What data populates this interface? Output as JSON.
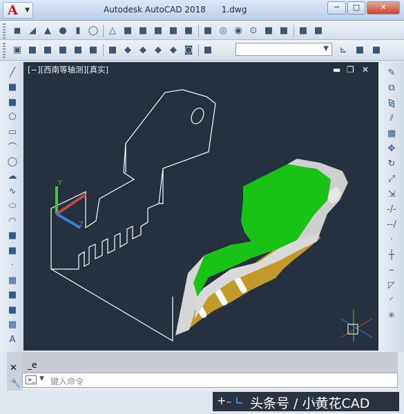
{
  "window": {
    "title": "Autodesk AutoCAD 2018      1.dwg",
    "logo_letter": "A",
    "minimize": "─",
    "maximize": "□",
    "close": "✕"
  },
  "viewport": {
    "label": "[−][西南等轴测][真实]",
    "minimize": "▬",
    "restore": "❐",
    "close": "✕"
  },
  "ucs": {
    "y_label": "Y",
    "z_label": "Z"
  },
  "command": {
    "history": "_e",
    "placeholder": "键入命令",
    "prompt_icon": ">_",
    "close": "✕"
  },
  "watermark": "头条号 / 小黄花CAD",
  "colors": {
    "viewport_bg": "#263140",
    "wireframe": "#ffffff",
    "green_face": "#19c316",
    "gold_face": "#c39a2a",
    "silver_face": "#d9d9d9"
  },
  "toolbar1_icons": [
    "box-icon",
    "wedge-icon",
    "cone-icon",
    "sphere-icon",
    "cylinder-icon",
    "torus-icon",
    "pyramid-icon",
    "planar-surface-icon",
    "extrude-icon",
    "presspull-icon",
    "sweep-icon",
    "revolve-icon",
    "loft-icon",
    "union-icon",
    "subtract-icon",
    "intersect-icon",
    "3d-move-icon",
    "3d-rotate-icon",
    "3d-align-icon",
    "3d-array-icon"
  ],
  "toolbar2_icons": [
    "view-icon",
    "top-view-icon",
    "bottom-view-icon",
    "left-view-icon",
    "right-view-icon",
    "front-view-icon",
    "back-view-icon",
    "sw-iso-icon",
    "se-iso-icon",
    "ne-iso-icon",
    "nw-iso-icon",
    "camera-icon",
    "named-views-icon",
    "ucs-icon",
    "ucs-world-icon",
    "ucs-previous-icon"
  ],
  "left_tools": [
    "line-icon",
    "construction-line-icon",
    "polyline-icon",
    "polygon-icon",
    "rectangle-icon",
    "arc-icon",
    "circle-icon",
    "revcloud-icon",
    "spline-icon",
    "ellipse-icon",
    "ellipse-arc-icon",
    "insert-block-icon",
    "make-block-icon",
    "point-icon",
    "hatch-icon",
    "gradient-icon",
    "region-icon",
    "table-icon",
    "mtext-icon"
  ],
  "right_tools": [
    "erase-icon",
    "copy-icon",
    "mirror-icon",
    "offset-icon",
    "array-icon",
    "move-icon",
    "rotate-icon",
    "scale-icon",
    "stretch-icon",
    "trim-icon",
    "extend-icon",
    "break-at-point-icon",
    "break-icon",
    "join-icon",
    "chamfer-icon",
    "fillet-icon",
    "explode-icon"
  ]
}
